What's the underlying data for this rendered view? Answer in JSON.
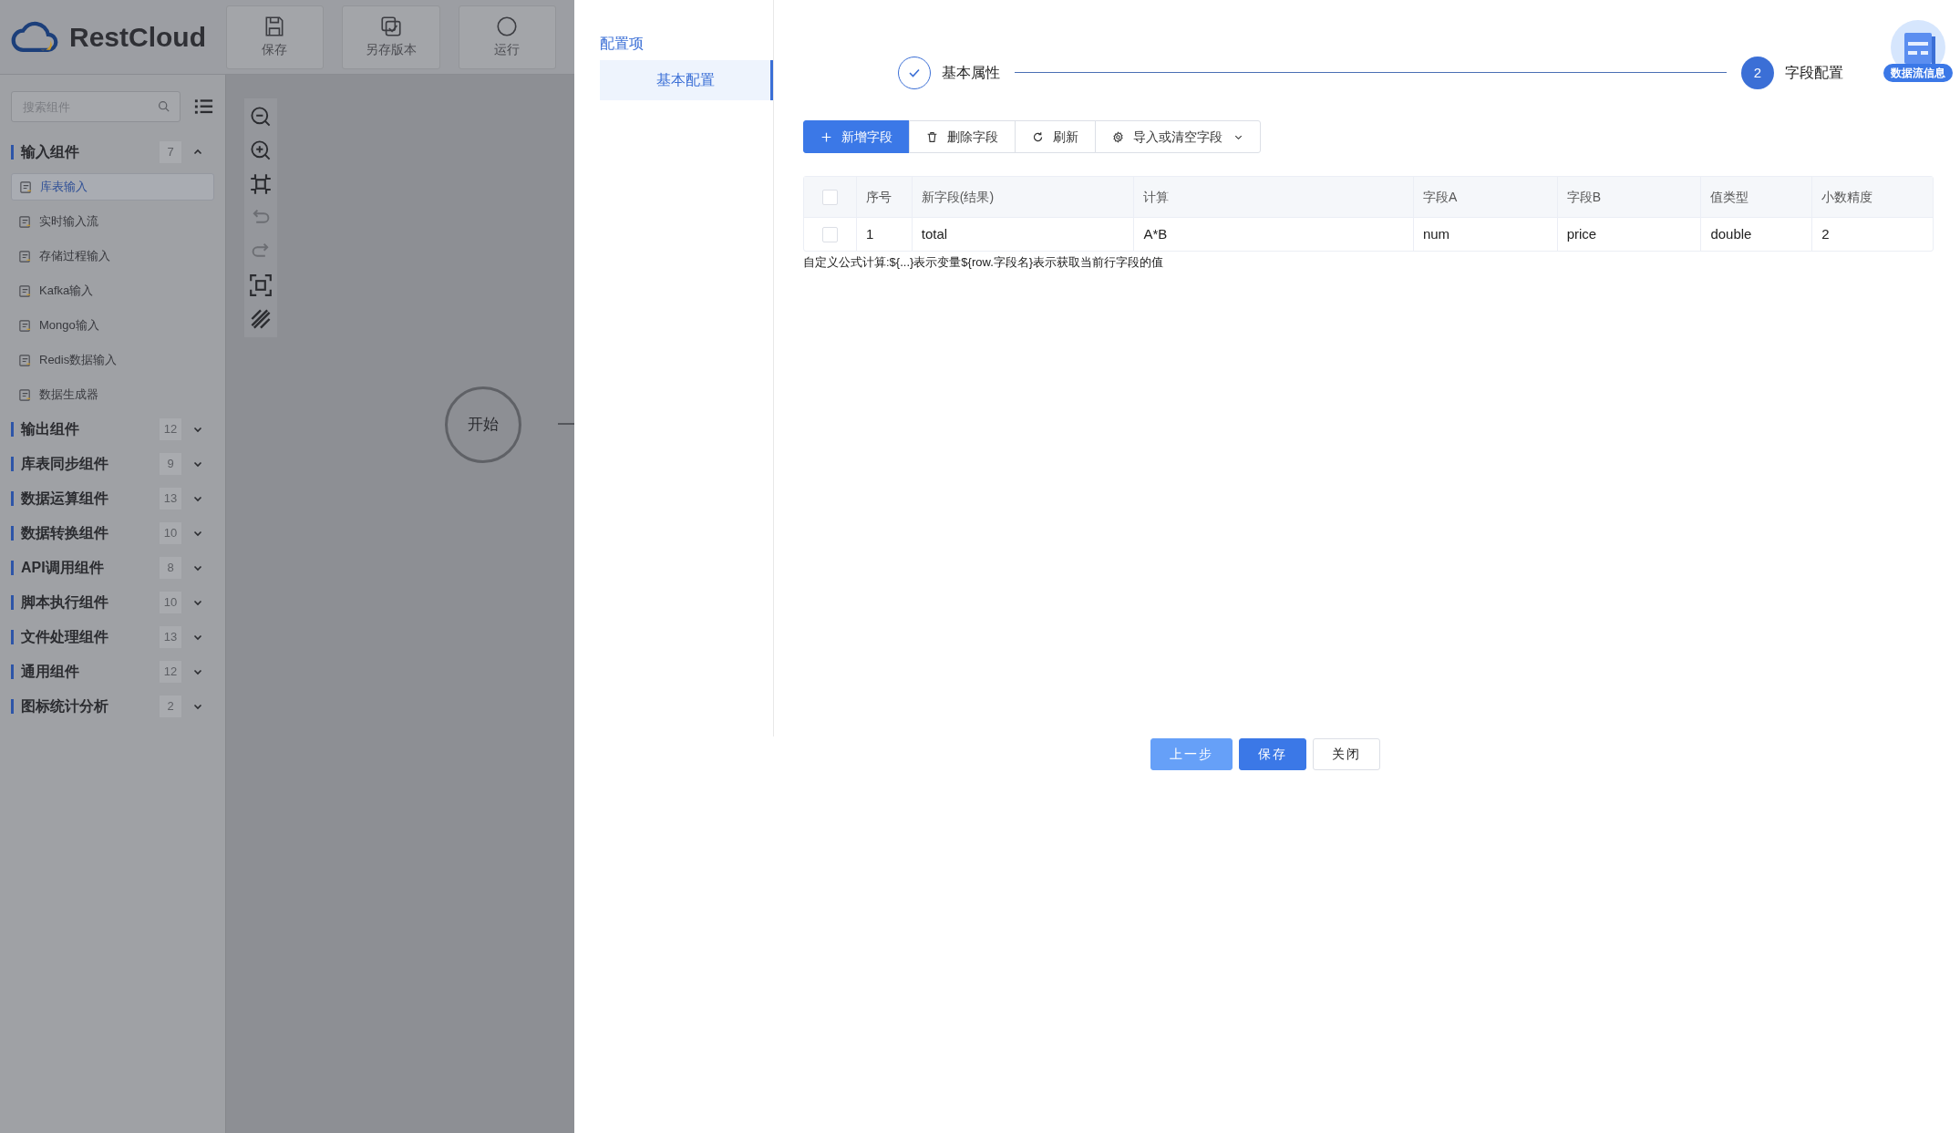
{
  "app": {
    "logo": "RestCloud",
    "toolbar": [
      {
        "label": "保存",
        "kind": "save"
      },
      {
        "label": "另存版本",
        "kind": "copy"
      },
      {
        "label": "运行",
        "kind": "run"
      }
    ]
  },
  "sidebar": {
    "search": {
      "placeholder": "搜索组件"
    },
    "groups": [
      {
        "label": "输入组件",
        "count": "7",
        "expanded": true,
        "items": [
          {
            "label": "库表输入",
            "selected": true
          },
          {
            "label": "实时输入流",
            "selected": false
          },
          {
            "label": "存储过程输入",
            "selected": false
          },
          {
            "label": "Kafka输入",
            "selected": false
          },
          {
            "label": "Mongo输入",
            "selected": false
          },
          {
            "label": "Redis数据输入",
            "selected": false
          },
          {
            "label": "数据生成器",
            "selected": false
          }
        ]
      },
      {
        "label": "输出组件",
        "count": "12",
        "expanded": false
      },
      {
        "label": "库表同步组件",
        "count": "9",
        "expanded": false
      },
      {
        "label": "数据运算组件",
        "count": "13",
        "expanded": false
      },
      {
        "label": "数据转换组件",
        "count": "10",
        "expanded": false
      },
      {
        "label": "API调用组件",
        "count": "8",
        "expanded": false
      },
      {
        "label": "脚本执行组件",
        "count": "10",
        "expanded": false
      },
      {
        "label": "文件处理组件",
        "count": "13",
        "expanded": false
      },
      {
        "label": "通用组件",
        "count": "12",
        "expanded": false
      },
      {
        "label": "图标统计分析",
        "count": "2",
        "expanded": false
      }
    ]
  },
  "canvas": {
    "node": "开始"
  },
  "drawer": {
    "section_title": "配置项",
    "tabs": [
      {
        "label": "基本配置",
        "selected": true
      }
    ],
    "steps": [
      {
        "label": "基本属性",
        "done": true
      },
      {
        "label": "字段配置",
        "done": false,
        "number": "2"
      }
    ],
    "badge": "数据流信息",
    "actions": [
      {
        "label": "新增字段",
        "kind": "plus",
        "primary": true,
        "dropdown": false
      },
      {
        "label": "删除字段",
        "kind": "trash",
        "primary": false,
        "dropdown": false
      },
      {
        "label": "刷新",
        "kind": "refresh",
        "primary": false,
        "dropdown": false
      },
      {
        "label": "导入或清空字段",
        "kind": "gear",
        "primary": false,
        "dropdown": true
      }
    ],
    "table": {
      "columns": [
        "序号",
        "新字段(结果)",
        "计算",
        "字段A",
        "字段B",
        "值类型",
        "小数精度"
      ],
      "rows": [
        {
          "checked": false,
          "cells": [
            "1",
            "total",
            "A*B",
            "num",
            "price",
            "double",
            "2"
          ]
        }
      ],
      "all_checked": false
    },
    "hint": "自定义公式计算:${...}表示变量${row.字段名}表示获取当前行字段的值",
    "buttons": [
      {
        "label": "上一步",
        "kind": "light"
      },
      {
        "label": "保存",
        "kind": "primary"
      },
      {
        "label": "关闭",
        "kind": "plain"
      }
    ]
  }
}
